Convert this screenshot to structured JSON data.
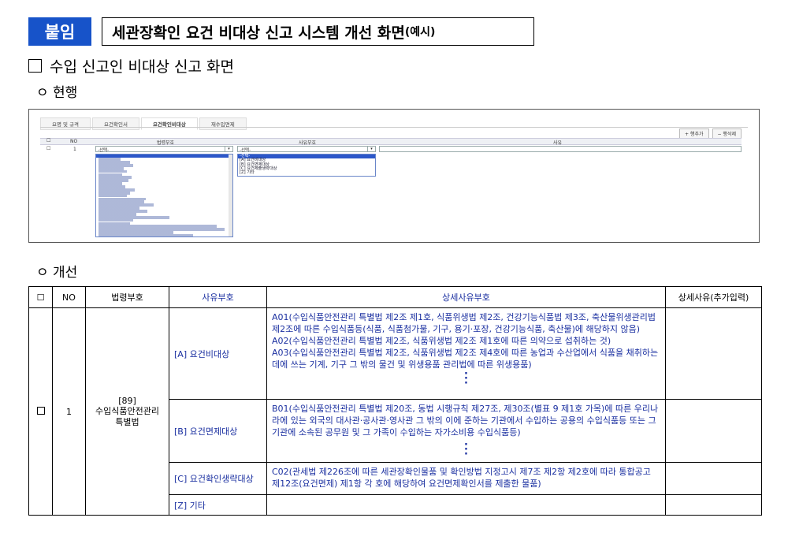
{
  "header": {
    "badge": "붙임",
    "title": "세관장확인 요건 비대상 신고 시스템 개선 화면",
    "title_sub": "(예시)"
  },
  "section": {
    "title": "수입 신고인 비대상 신고 화면",
    "current": "ㅇ 현행",
    "improved": "ㅇ 개선"
  },
  "screenshot": {
    "tabs": [
      "요명 및 규격",
      "요건확인서",
      "요건확인비대상",
      "재수입면제"
    ],
    "buttons": [
      "+ 행추가",
      "− 행삭제"
    ],
    "headers": [
      "NO",
      "법령부호",
      "사유부호",
      "사유"
    ],
    "row_no": "1",
    "select_placeholder_1": "-선택-",
    "select_placeholder_2": "-선택-",
    "reason_options": [
      "-선택-",
      "[A] 요건비대상",
      "[B] 요건면제대상",
      "[C] 요건제출생략대상",
      "[Z] 기타"
    ]
  },
  "table": {
    "headers": [
      "☐",
      "NO",
      "법령부호",
      "사유부호",
      "상세사유부호",
      "상세사유(추가입력)"
    ],
    "row": {
      "no": "1",
      "law_code": "[89]",
      "law_name": "수입식품안전관리 특별법",
      "reasons": [
        {
          "code": "[A] 요건비대상",
          "details": [
            "A01(수입식품안전관리 특별법 제2조 제1호, 식품위생법 제2조, 건강기능식품법 제3조, 축산물위생관리법 제2조에 따른 수입식품등(식품, 식품첨가물, 기구, 용기·포장, 건강기능식품, 축산물)에 해당하지 않음)",
            "A02(수입식품안전관리 특별법 제2조, 식품위생법 제2조 제1호에 따른 의약으로 섭취하는 것)",
            "A03(수입식품안전관리 특별법 제2조, 식품위생법 제2조 제4호에 따른 농업과 수산업에서 식품을 채취하는 데에 쓰는 기계, 기구 그 밖의 물건 및 위생용품 관리법에 따른 위생용품)"
          ]
        },
        {
          "code": "[B] 요건면제대상",
          "details": [
            "B01(수입식품안전관리 특별법 제20조, 동법 시행규칙 제27조, 제30조(별표 9 제1호 가목)에 따른 우리나라에 있는 외국의 대사관·공사관·영사관 그 밖의 이에 준하는 기관에서 수입하는 공용의 수입식품등 또는 그 기관에 소속된 공무원 및 그 가족이 수입하는 자가소비용 수입식품등)"
          ]
        },
        {
          "code": "[C] 요건확인생략대상",
          "details": [
            "C02(관세법 제226조에 따른 세관장확인물품 및 확인방법 지정고시 제7조 제2항 제2호에 따라 통합공고 제12조(요건면제) 제1항 각 호에 해당하여 요건면제확인서를 제출한 물품)"
          ]
        },
        {
          "code": "[Z] 기타",
          "details": []
        }
      ]
    }
  }
}
